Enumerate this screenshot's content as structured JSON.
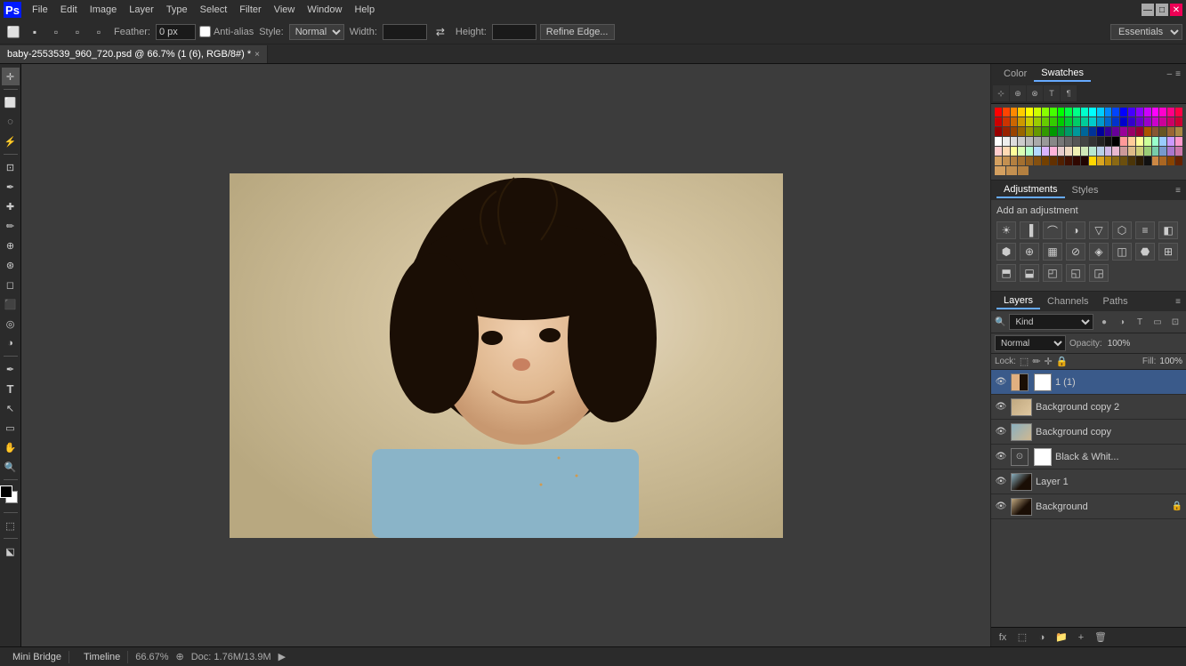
{
  "app": {
    "logo": "Ps",
    "workspace": "Essentials",
    "window_title": "baby-2553539_960_720.psd @ 66.7% (1 (6), RGB/8#) *"
  },
  "menubar": {
    "items": [
      "File",
      "Edit",
      "Image",
      "Layer",
      "Type",
      "Select",
      "Filter",
      "View",
      "Window",
      "Help"
    ]
  },
  "toolbar": {
    "feather_label": "Feather:",
    "feather_value": "0 px",
    "anti_alias_label": "Anti-alias",
    "style_label": "Style:",
    "style_value": "Normal",
    "width_label": "Width:",
    "height_label": "Height:",
    "refine_edge_btn": "Refine Edge...",
    "workspace_label": "Essentials"
  },
  "tab": {
    "title": "baby-2553539_960_720.psd @ 66.7% (1 (6), RGB/8#) *",
    "close": "×"
  },
  "swatches_panel": {
    "color_tab": "Color",
    "swatches_tab": "Swatches",
    "panel_menu": "≡",
    "expand": "▶"
  },
  "adjustments_panel": {
    "adjustments_tab": "Adjustments",
    "styles_tab": "Styles",
    "add_adjustment_label": "Add an adjustment"
  },
  "layers_panel": {
    "layers_tab": "Layers",
    "channels_tab": "Channels",
    "paths_tab": "Paths",
    "kind_label": "Kind",
    "blend_mode": "Normal",
    "opacity_label": "Opacity:",
    "opacity_value": "100%",
    "lock_label": "Lock:",
    "fill_label": "Fill:",
    "fill_value": "100%",
    "layers": [
      {
        "id": "l1",
        "name": "1 (1)",
        "type": "group",
        "visible": true,
        "locked": false,
        "active": true
      },
      {
        "id": "l2",
        "name": "Background copy 2",
        "type": "photo2",
        "visible": true,
        "locked": false,
        "active": false
      },
      {
        "id": "l3",
        "name": "Background copy",
        "type": "photo",
        "visible": true,
        "locked": false,
        "active": false
      },
      {
        "id": "l4",
        "name": "Black & Whit...",
        "type": "black-white",
        "visible": true,
        "locked": false,
        "active": false
      },
      {
        "id": "l5",
        "name": "Layer 1",
        "type": "photo",
        "visible": true,
        "locked": false,
        "active": false
      },
      {
        "id": "l6",
        "name": "Background",
        "type": "photo2",
        "visible": true,
        "locked": true,
        "active": false
      }
    ]
  },
  "bottom": {
    "zoom": "66.67%",
    "status": "Doc: 1.76M/13.9M",
    "mini_bridge_tab": "Mini Bridge",
    "timeline_tab": "Timeline"
  },
  "swatches": {
    "row1": [
      "#ff0000",
      "#ff4400",
      "#ff8800",
      "#ffcc00",
      "#ffff00",
      "#ccff00",
      "#88ff00",
      "#44ff00",
      "#00ff00",
      "#00ff44",
      "#00ff88",
      "#00ffcc",
      "#00ffff",
      "#00ccff",
      "#0088ff",
      "#0044ff",
      "#0000ff",
      "#4400ff",
      "#8800ff",
      "#cc00ff",
      "#ff00ff",
      "#ff00cc",
      "#ff0088",
      "#ff0044"
    ],
    "row2": [
      "#cc0000",
      "#cc3300",
      "#cc6600",
      "#cc9900",
      "#cccc00",
      "#99cc00",
      "#66cc00",
      "#33cc00",
      "#00cc00",
      "#00cc33",
      "#00cc66",
      "#00cc99",
      "#00cccc",
      "#0099cc",
      "#0066cc",
      "#0033cc",
      "#0000cc",
      "#3300cc",
      "#6600cc",
      "#9900cc",
      "#cc00cc",
      "#cc0099",
      "#cc0066",
      "#cc0033"
    ],
    "row3": [
      "#990000",
      "#992200",
      "#994400",
      "#996600",
      "#999900",
      "#669900",
      "#339900",
      "#009900",
      "#009933",
      "#009966",
      "#009999",
      "#006699",
      "#003399",
      "#000099",
      "#330099",
      "#660099",
      "#990099",
      "#990066",
      "#990033",
      "#aa5500",
      "#885533",
      "#665522",
      "#996633",
      "#aa8844"
    ],
    "row4": [
      "#ffffff",
      "#eeeeee",
      "#dddddd",
      "#cccccc",
      "#bbbbbb",
      "#aaaaaa",
      "#999999",
      "#888888",
      "#777777",
      "#666666",
      "#555555",
      "#444444",
      "#333333",
      "#222222",
      "#111111",
      "#000000",
      "#ff9999",
      "#ffcc99",
      "#ffff99",
      "#ccff99",
      "#99ffcc",
      "#99ccff",
      "#cc99ff",
      "#ff99cc"
    ],
    "row5": [
      "#ffcccc",
      "#ffd9b3",
      "#ffff99",
      "#d9ffb3",
      "#b3ffcc",
      "#b3d9ff",
      "#d9b3ff",
      "#ffb3d9",
      "#e6cccc",
      "#f0d9c0",
      "#f0f0b3",
      "#d0e8b8",
      "#b8e8d0",
      "#b8d0e8",
      "#d0b8e8",
      "#e8b8d0",
      "#cc9999",
      "#ddbb88",
      "#cccc77",
      "#99cc77",
      "#77ccaa",
      "#7799cc",
      "#aa77cc",
      "#cc77aa"
    ],
    "row6": [
      "#d4a060",
      "#c49050",
      "#b48040",
      "#a47030",
      "#946020",
      "#845010",
      "#734000",
      "#623000",
      "#512000",
      "#401000",
      "#300800",
      "#200400",
      "#ffd700",
      "#daa520",
      "#b8860b",
      "#8b6914",
      "#6b4f0e",
      "#4b3508",
      "#2b1b04",
      "#111111",
      "#cc8844",
      "#aa6622",
      "#884400",
      "#662200"
    ],
    "extra": [
      "#d4a060",
      "#c49050",
      "#b48040"
    ]
  }
}
